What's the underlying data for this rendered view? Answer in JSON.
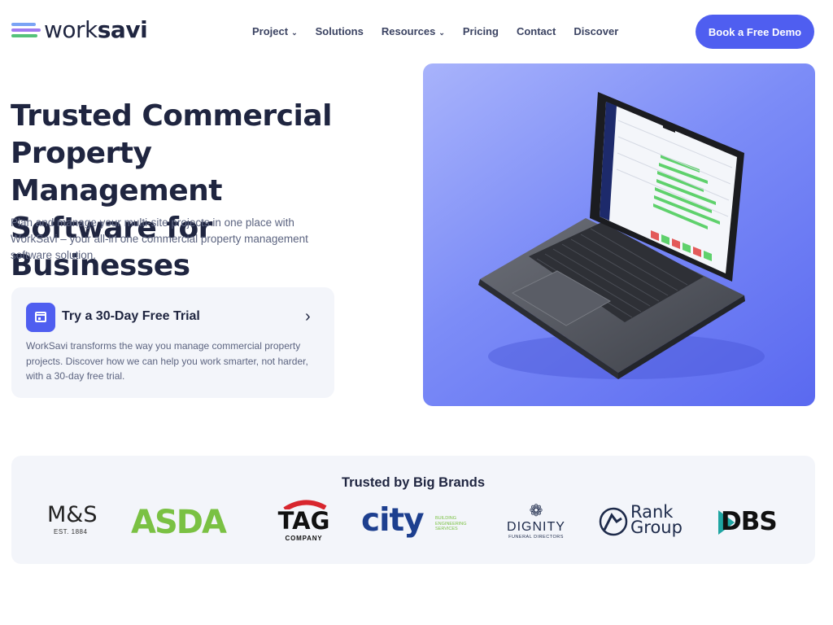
{
  "brand": {
    "logo_prefix": "work",
    "logo_suffix": "savi"
  },
  "nav": {
    "items": [
      {
        "label": "Project",
        "has_dropdown": true
      },
      {
        "label": "Solutions",
        "has_dropdown": false
      },
      {
        "label": "Resources",
        "has_dropdown": true
      },
      {
        "label": "Pricing",
        "has_dropdown": false
      },
      {
        "label": "Contact",
        "has_dropdown": false
      },
      {
        "label": "Discover",
        "has_dropdown": false
      }
    ],
    "cta_label": "Book a Free Demo"
  },
  "hero": {
    "title_line1": "Trusted Commercial",
    "title_line2": "Property Management",
    "title_line3": "Software for Businesses",
    "subtitle": "Plan and manage your multi-site projects in one place with WorkSavi – your all-in one commercial property management software solution."
  },
  "trial_card": {
    "title": "Try a 30-Day Free Trial",
    "description": "WorkSavi transforms the way you manage commercial property projects. Discover how we can help you work smarter, not harder, with a 30-day free trial."
  },
  "brands": {
    "title": "Trusted by Big Brands",
    "logos": [
      {
        "name": "M&S",
        "sub": "EST. 1884"
      },
      {
        "name": "ASDA"
      },
      {
        "name": "TAG",
        "sub": "COMPANY"
      },
      {
        "name": "city",
        "sub": "BUILDING ENGINEERING SERVICES"
      },
      {
        "name": "DIGNITY",
        "sub": "FUNERAL DIRECTORS"
      },
      {
        "name": "Rank",
        "name2": "Group"
      },
      {
        "name": "DBS"
      }
    ]
  },
  "colors": {
    "accent": "#4f5ef0",
    "heading": "#1f2540",
    "body_text": "#5c6480",
    "card_bg": "#f3f5fa",
    "asda_green": "#7ac143",
    "city_blue": "#1d3f8f"
  }
}
